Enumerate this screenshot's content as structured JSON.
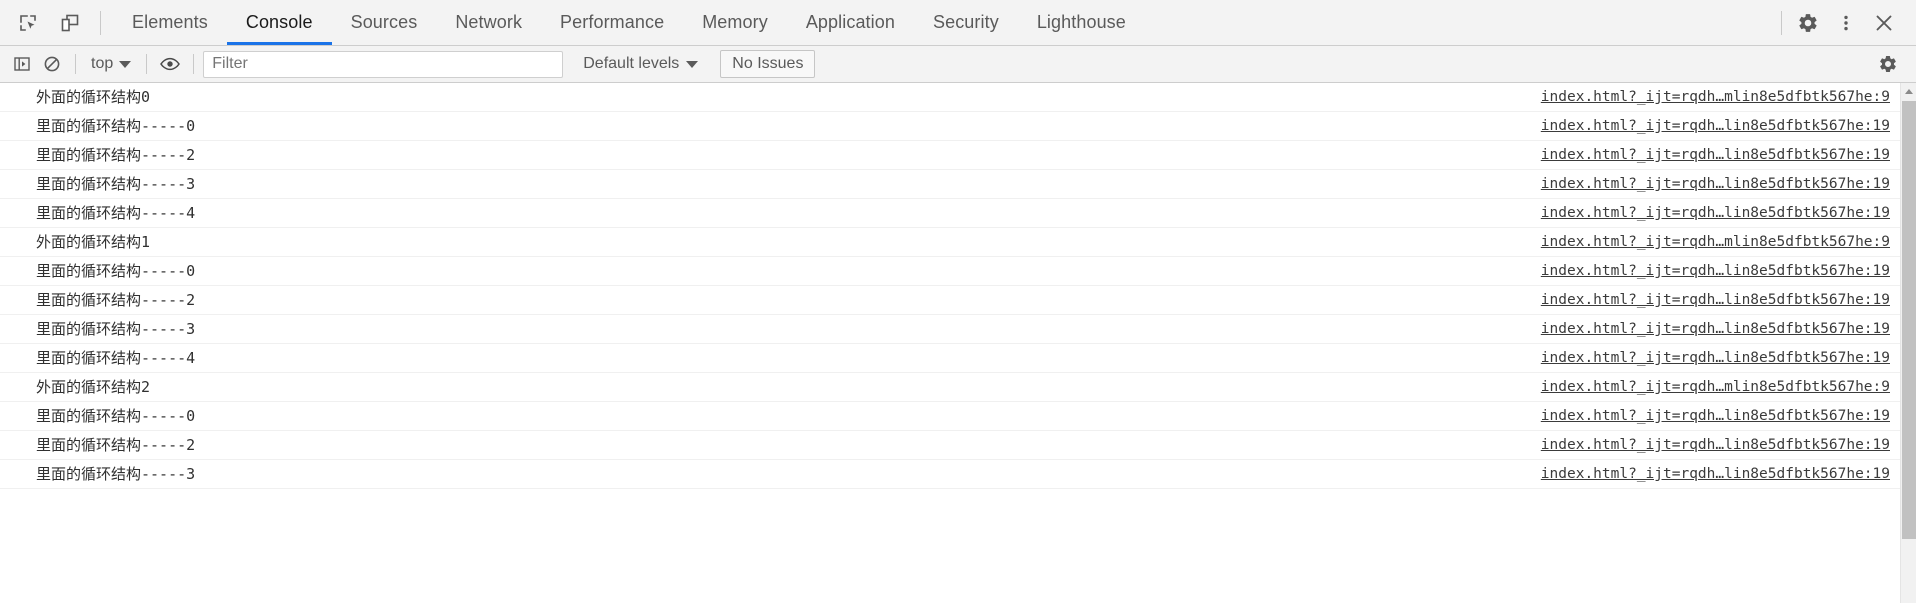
{
  "tabbar": {
    "inspect_icon": "inspect-element-icon",
    "device_icon": "device-toolbar-icon",
    "tabs": [
      {
        "id": "elements",
        "label": "Elements",
        "active": false
      },
      {
        "id": "console",
        "label": "Console",
        "active": true
      },
      {
        "id": "sources",
        "label": "Sources",
        "active": false
      },
      {
        "id": "network",
        "label": "Network",
        "active": false
      },
      {
        "id": "performance",
        "label": "Performance",
        "active": false
      },
      {
        "id": "memory",
        "label": "Memory",
        "active": false
      },
      {
        "id": "application",
        "label": "Application",
        "active": false
      },
      {
        "id": "security",
        "label": "Security",
        "active": false
      },
      {
        "id": "lighthouse",
        "label": "Lighthouse",
        "active": false
      }
    ],
    "right_icons": [
      "settings-gear-icon",
      "more-options-icon",
      "close-devtools-icon"
    ],
    "active_underline_color": "#1a73e8"
  },
  "filterbar": {
    "sidebar_toggle_icon": "console-sidebar-icon",
    "clear_console_icon": "clear-console-icon",
    "context_value": "top",
    "eye_icon": "live-expression-eye-icon",
    "filter_placeholder": "Filter",
    "filter_value": "",
    "levels_label": "Default levels",
    "issues_label": "No Issues",
    "settings_icon": "console-settings-gear-icon"
  },
  "console": {
    "messages": [
      {
        "text": "外面的循环结构0",
        "source": "index.html?_ijt=rqdh…mlin8e5dfbtk567he:9"
      },
      {
        "text": "里面的循环结构-----0",
        "source": "index.html?_ijt=rqdh…lin8e5dfbtk567he:19"
      },
      {
        "text": "里面的循环结构-----2",
        "source": "index.html?_ijt=rqdh…lin8e5dfbtk567he:19"
      },
      {
        "text": "里面的循环结构-----3",
        "source": "index.html?_ijt=rqdh…lin8e5dfbtk567he:19"
      },
      {
        "text": "里面的循环结构-----4",
        "source": "index.html?_ijt=rqdh…lin8e5dfbtk567he:19"
      },
      {
        "text": "外面的循环结构1",
        "source": "index.html?_ijt=rqdh…mlin8e5dfbtk567he:9"
      },
      {
        "text": "里面的循环结构-----0",
        "source": "index.html?_ijt=rqdh…lin8e5dfbtk567he:19"
      },
      {
        "text": "里面的循环结构-----2",
        "source": "index.html?_ijt=rqdh…lin8e5dfbtk567he:19"
      },
      {
        "text": "里面的循环结构-----3",
        "source": "index.html?_ijt=rqdh…lin8e5dfbtk567he:19"
      },
      {
        "text": "里面的循环结构-----4",
        "source": "index.html?_ijt=rqdh…lin8e5dfbtk567he:19"
      },
      {
        "text": "外面的循环结构2",
        "source": "index.html?_ijt=rqdh…mlin8e5dfbtk567he:9"
      },
      {
        "text": "里面的循环结构-----0",
        "source": "index.html?_ijt=rqdh…lin8e5dfbtk567he:19"
      },
      {
        "text": "里面的循环结构-----2",
        "source": "index.html?_ijt=rqdh…lin8e5dfbtk567he:19"
      },
      {
        "text": "里面的循环结构-----3",
        "source": "index.html?_ijt=rqdh…lin8e5dfbtk567he:19"
      }
    ]
  }
}
